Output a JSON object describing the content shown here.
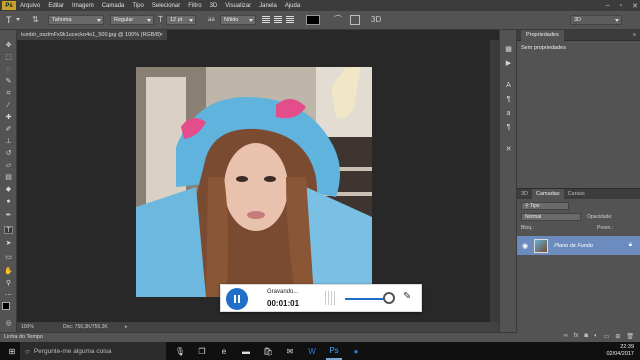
{
  "menubar": {
    "logo": "Ps",
    "items": [
      "Arquivo",
      "Editar",
      "Imagem",
      "Camada",
      "Tipo",
      "Selecionar",
      "Filtro",
      "3D",
      "Visualizar",
      "Janela",
      "Ajuda"
    ]
  },
  "options": {
    "font_family": "Tahoma",
    "font_style": "Regular",
    "font_size": "12 pt",
    "antialias": "Nítido",
    "workspace": "3D"
  },
  "document": {
    "tab_title": "tumblr_oszlmFx9k1ucecko4o1_500.jpg @ 100% (RGB/8)",
    "zoom": "100%",
    "doc_info": "Doc: 756,3K/756,3K"
  },
  "panels": {
    "properties_title": "Propriedades",
    "properties_empty": "Sem propriedades",
    "layer_tabs": [
      "3D",
      "Camadas",
      "Canais"
    ],
    "layer_filter": "Tipo",
    "blend_mode": "Normal",
    "opacity_label": "Opacidade:",
    "fill_label": "Preen.:",
    "lock_label": "Bloq.:",
    "layer_name": "Plano de Fundo"
  },
  "timeline": {
    "label": "Linha do Tempo"
  },
  "recorder": {
    "status": "Gravando...",
    "time": "00:01:01"
  },
  "taskbar": {
    "search_placeholder": "Pergunte-me alguma coisa",
    "time": "22:39",
    "date": "02/04/2017"
  }
}
